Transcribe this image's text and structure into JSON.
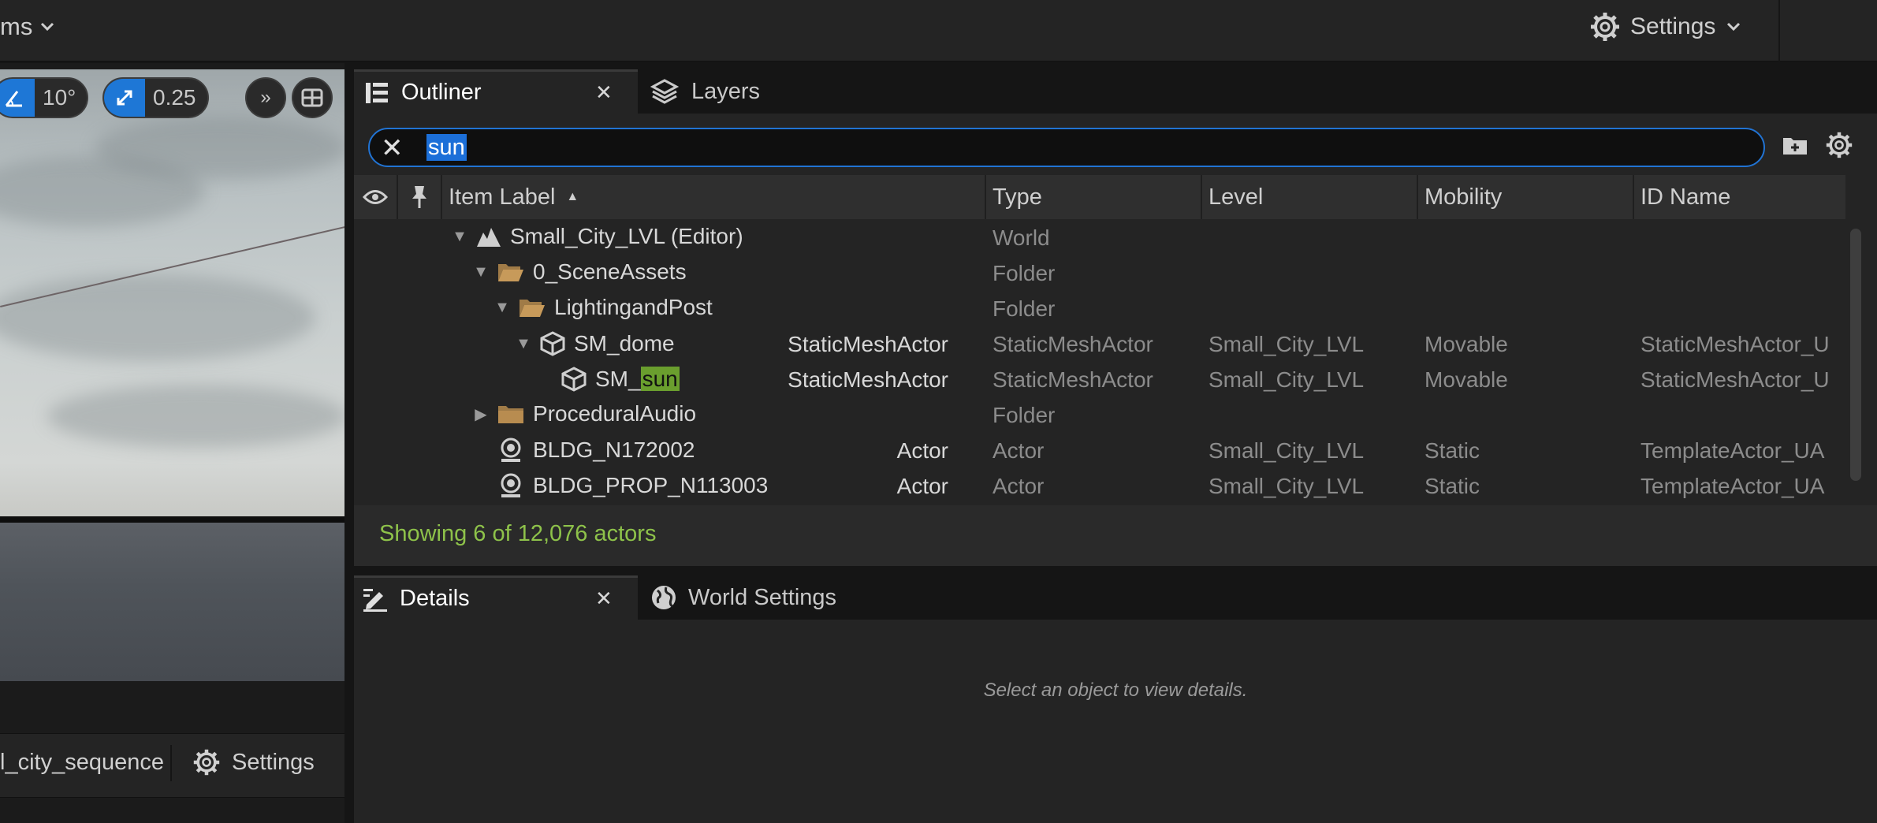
{
  "topbar": {
    "left_label": "ms",
    "settings_label": "Settings"
  },
  "viewport": {
    "angle_snap": "10°",
    "scale_snap": "0.25",
    "sequence_name": "l_city_sequence",
    "settings_label": "Settings"
  },
  "outliner": {
    "tabs": [
      {
        "label": "Outliner",
        "active": true
      },
      {
        "label": "Layers",
        "active": false
      }
    ],
    "search_query": "sun",
    "columns": [
      "Item Label",
      "Type",
      "Level",
      "Mobility",
      "ID Name"
    ],
    "sort_indicator": "▲",
    "rows": [
      {
        "label": "Small_City_LVL (Editor)",
        "class": "",
        "type": "World",
        "level": "",
        "mobility": "",
        "id_name": "",
        "icon": "world-icon",
        "expander": "expanded"
      },
      {
        "label": "0_SceneAssets",
        "class": "",
        "type": "Folder",
        "level": "",
        "mobility": "",
        "id_name": "",
        "icon": "folder-open-icon",
        "expander": "expanded"
      },
      {
        "label": "LightingandPost",
        "class": "",
        "type": "Folder",
        "level": "",
        "mobility": "",
        "id_name": "",
        "icon": "folder-open-icon",
        "expander": "expanded"
      },
      {
        "label": "SM_dome",
        "class": "StaticMeshActor",
        "type": "StaticMeshActor",
        "level": "Small_City_LVL",
        "mobility": "Movable",
        "id_name": "StaticMeshActor_U",
        "icon": "static-mesh-icon",
        "expander": "expanded"
      },
      {
        "label_prefix": "SM_",
        "label_match": "sun",
        "class": "StaticMeshActor",
        "type": "StaticMeshActor",
        "level": "Small_City_LVL",
        "mobility": "Movable",
        "id_name": "StaticMeshActor_U",
        "icon": "static-mesh-icon",
        "expander": "none"
      },
      {
        "label": "ProceduralAudio",
        "class": "",
        "type": "Folder",
        "level": "",
        "mobility": "",
        "id_name": "",
        "icon": "folder-closed-icon",
        "expander": "collapsed"
      },
      {
        "label": "BLDG_N172002",
        "class": "Actor",
        "type": "Actor",
        "level": "Small_City_LVL",
        "mobility": "Static",
        "id_name": "TemplateActor_UA",
        "icon": "actor-icon",
        "expander": "none"
      },
      {
        "label": "BLDG_PROP_N113003",
        "class": "Actor",
        "type": "Actor",
        "level": "Small_City_LVL",
        "mobility": "Static",
        "id_name": "TemplateActor_UA",
        "icon": "actor-icon",
        "expander": "none"
      }
    ],
    "status": "Showing 6 of 12,076 actors"
  },
  "details": {
    "tabs": [
      {
        "label": "Details",
        "active": true
      },
      {
        "label": "World Settings",
        "active": false
      }
    ],
    "empty_message": "Select an object to view details."
  },
  "colors": {
    "accent_blue": "#1e77d6",
    "match_highlight": "#6a9e2e",
    "status_green": "#8ec24a",
    "panel_bg": "#242424"
  }
}
